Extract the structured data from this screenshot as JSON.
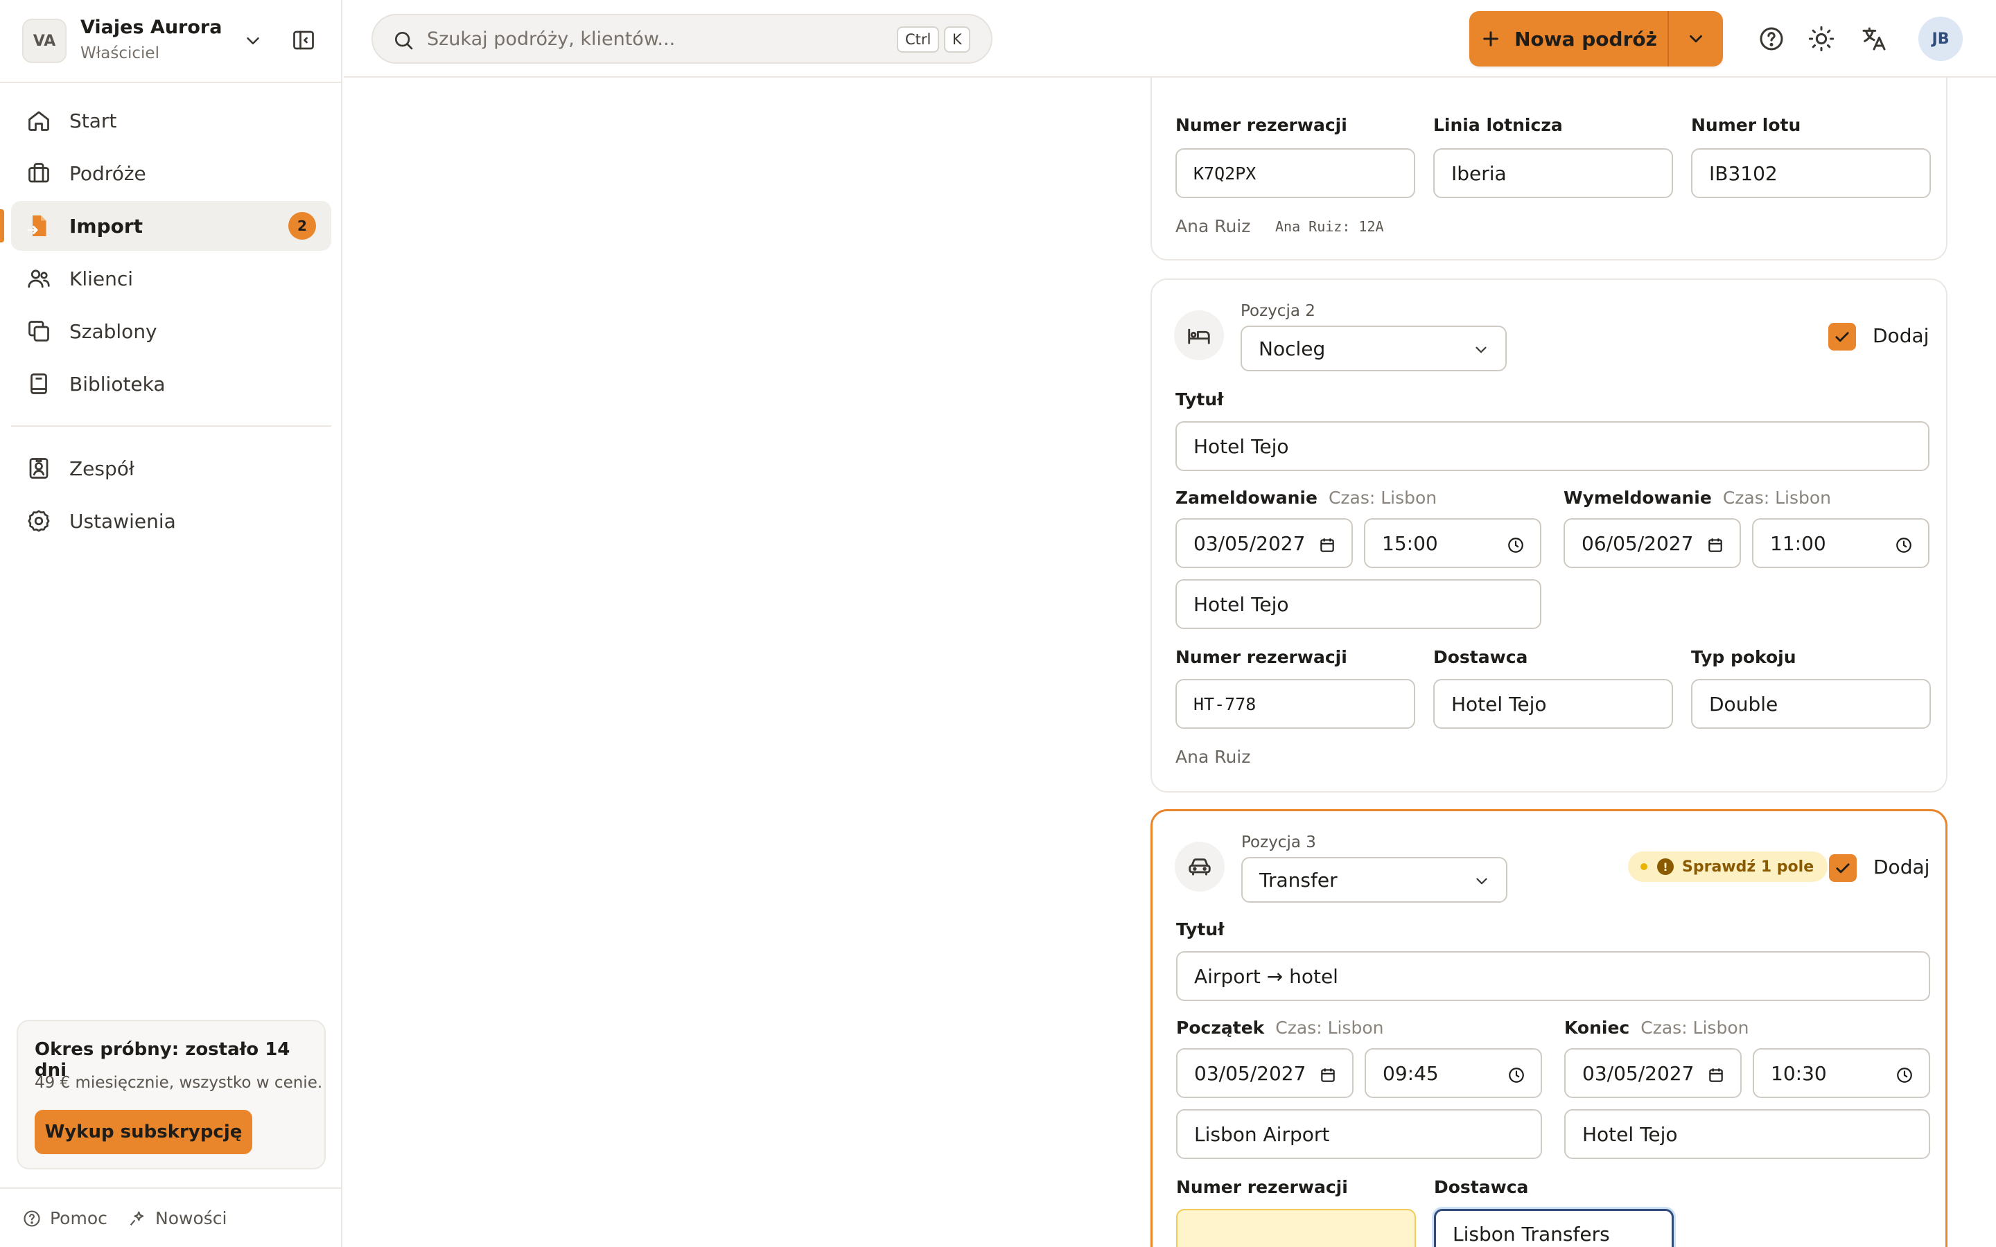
{
  "workspace": {
    "initials": "VA",
    "name": "Viajes Aurora",
    "role": "Właściciel"
  },
  "nav": {
    "start": "Start",
    "trips": "Podróże",
    "import": "Import",
    "import_badge": "2",
    "clients": "Klienci",
    "templates": "Szablony",
    "library": "Biblioteka",
    "team": "Zespół",
    "settings": "Ustawienia"
  },
  "trial": {
    "title": "Okres próbny: zostało 14 dni",
    "subtitle": "49 € miesięcznie, wszystko w cenie.",
    "button": "Wykup subskrypcję"
  },
  "footer": {
    "help": "Pomoc",
    "news": "Nowości"
  },
  "topbar": {
    "search_placeholder": "Szukaj podróży, klientów...",
    "kbd_ctrl": "Ctrl",
    "kbd_k": "K",
    "new_trip": "Nowa podróż",
    "user_initials": "JB"
  },
  "item1": {
    "booking_label": "Numer rezerwacji",
    "booking_value": "K7Q2PX",
    "airline_label": "Linia lotnicza",
    "airline_value": "Iberia",
    "flight_label": "Numer lotu",
    "flight_value": "IB3102",
    "traveler": "Ana Ruiz",
    "seat_note": "Ana Ruiz: 12A"
  },
  "item2": {
    "position": "Pozycja 2",
    "type": "Nocleg",
    "include_label": "Dodaj",
    "title_label": "Tytuł",
    "title_value": "Hotel Tejo",
    "start_label": "Zameldowanie",
    "start_tz": "Czas: Lisbon",
    "start_date": "03/05/2027",
    "start_time": "15:00",
    "end_label": "Wymeldowanie",
    "end_tz": "Czas: Lisbon",
    "end_date": "06/05/2027",
    "end_time": "11:00",
    "location": "Hotel Tejo",
    "booking_label": "Numer rezerwacji",
    "booking_value": "HT-778",
    "supplier_label": "Dostawca",
    "supplier_value": "Hotel Tejo",
    "room_label": "Typ pokoju",
    "room_value": "Double",
    "traveler": "Ana Ruiz"
  },
  "item3": {
    "position": "Pozycja 3",
    "type": "Transfer",
    "warning": "Sprawdź 1 pole",
    "include_label": "Dodaj",
    "title_label": "Tytuł",
    "title_value": "Airport → hotel",
    "start_label": "Początek",
    "start_tz": "Czas: Lisbon",
    "start_date": "03/05/2027",
    "start_time": "09:45",
    "end_label": "Koniec",
    "end_tz": "Czas: Lisbon",
    "end_date": "03/05/2027",
    "end_time": "10:30",
    "from": "Lisbon Airport",
    "to": "Hotel Tejo",
    "booking_label": "Numer rezerwacji",
    "booking_value": "",
    "supplier_label": "Dostawca",
    "supplier_value": "Lisbon Transfers"
  },
  "colors": {
    "accent": "#e9852a",
    "warning_bg": "#fdf0c2",
    "focus": "#2f4c7a"
  }
}
